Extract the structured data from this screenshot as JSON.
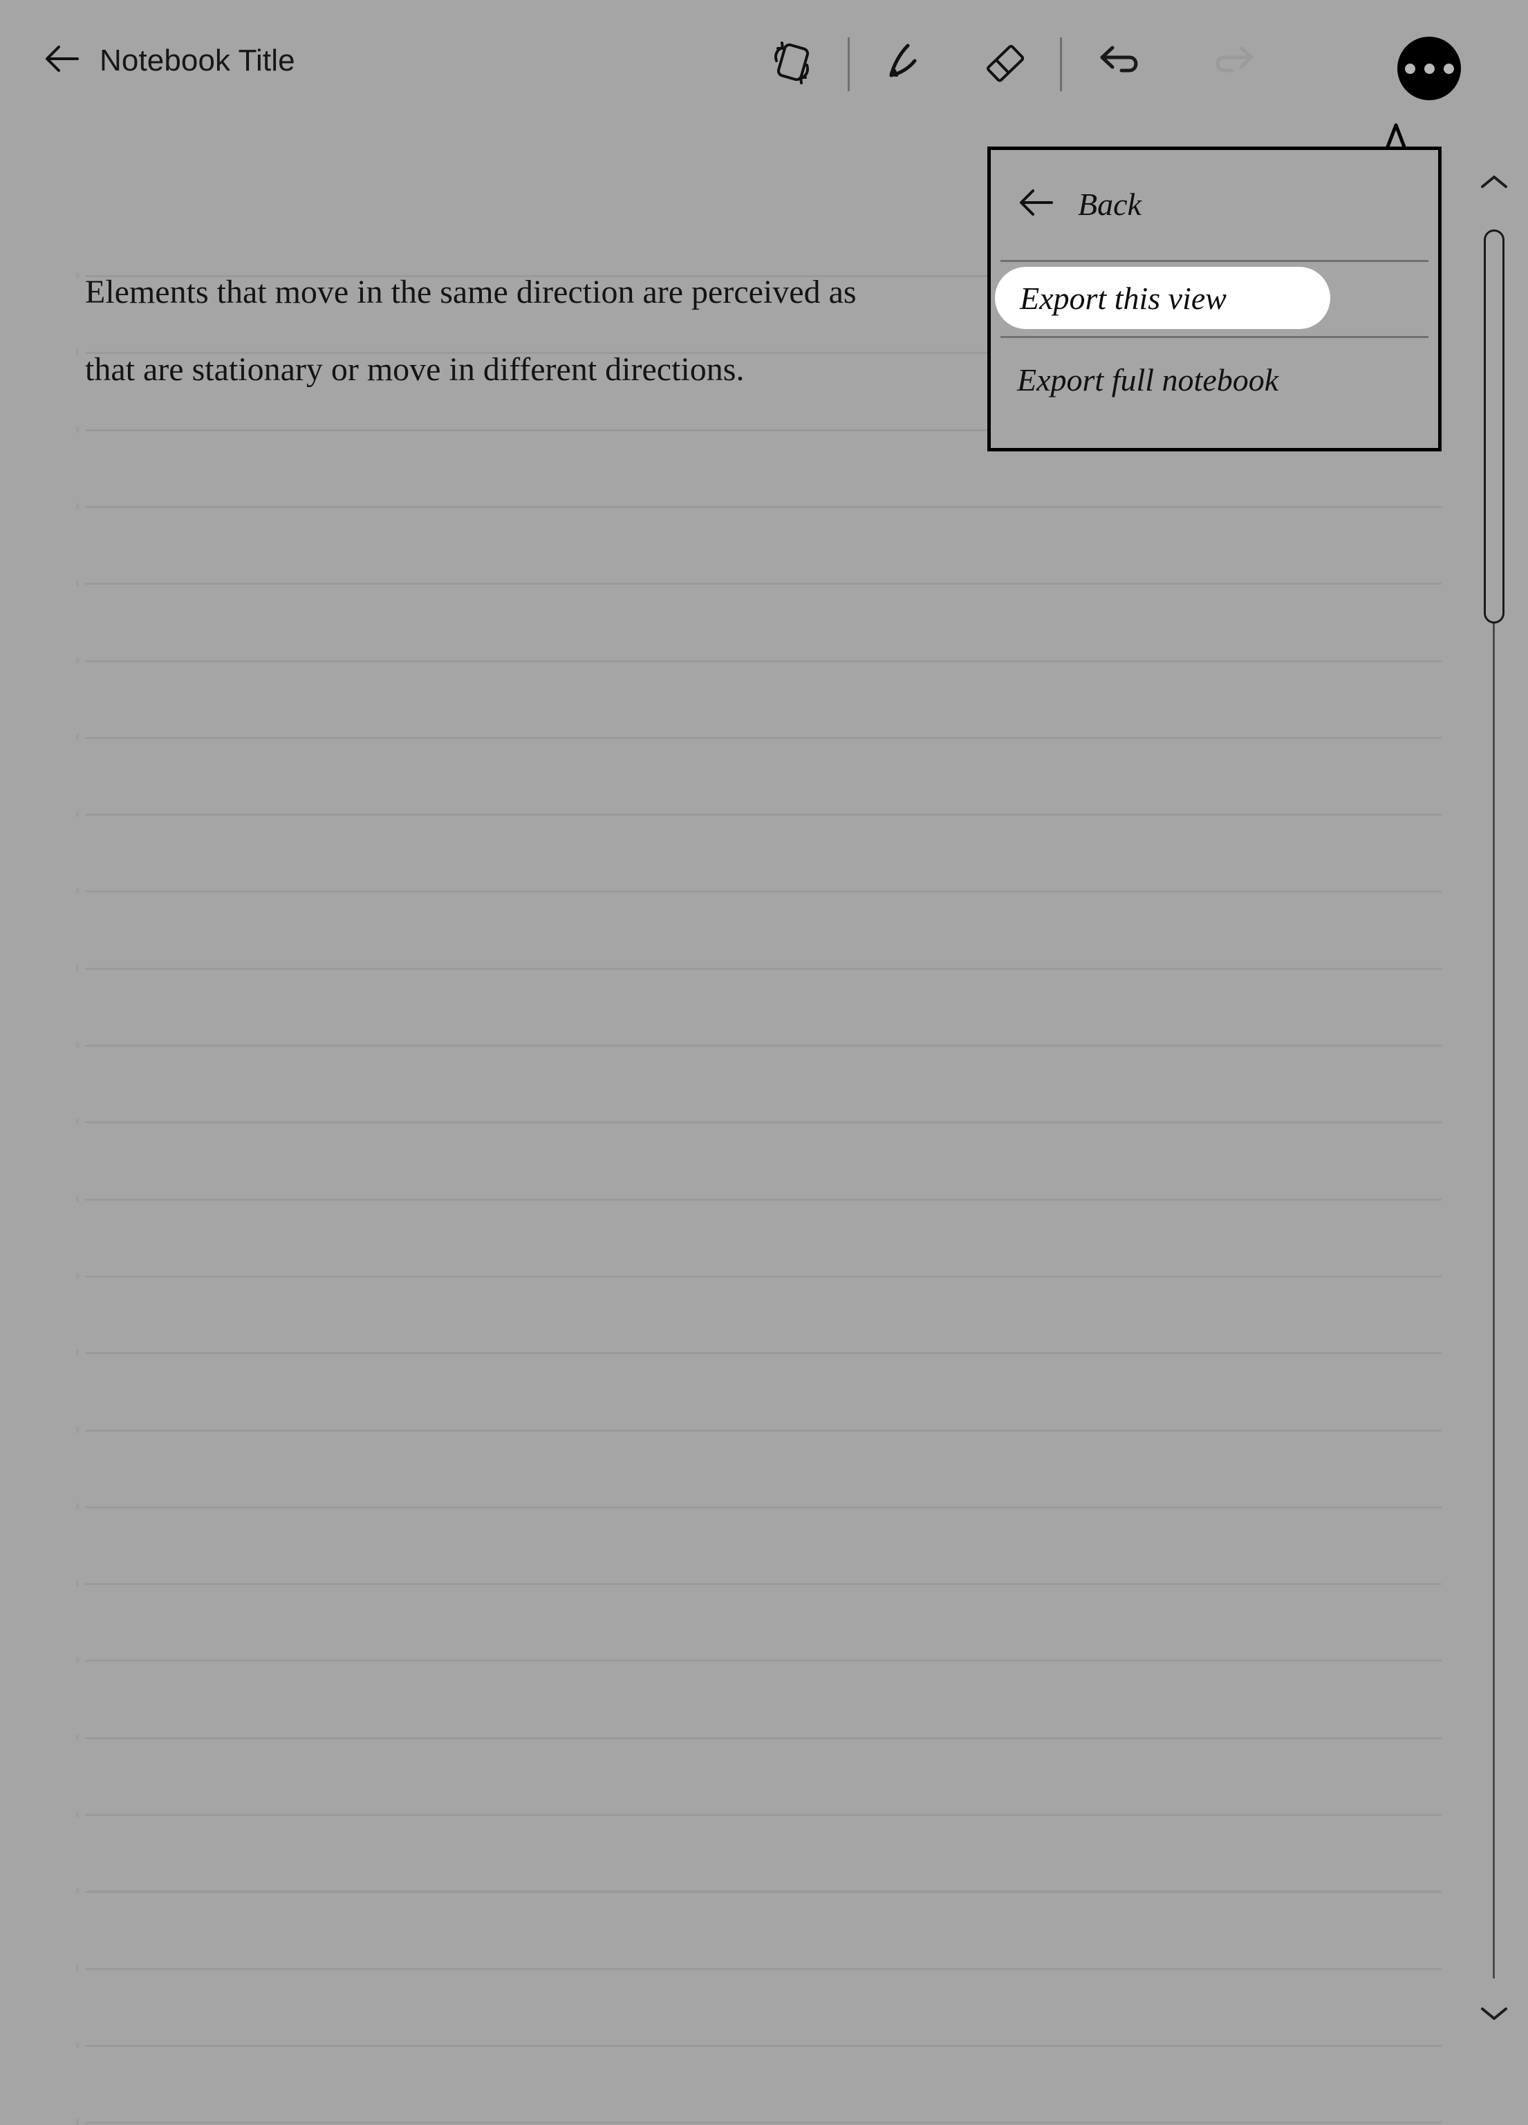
{
  "theme": {
    "background": "#a5a5a5",
    "rule_line_color": "#9a9a9a",
    "ink": "#111111",
    "accent_button": "#000000",
    "highlight_pill": "#ffffff"
  },
  "header": {
    "back_icon": "arrow-left-icon",
    "title": "Notebook Title",
    "tools": [
      {
        "name": "rotate-view-icon",
        "label": "Rotate view",
        "state": "enabled"
      },
      {
        "name": "pen-icon",
        "label": "Pen",
        "state": "enabled"
      },
      {
        "name": "eraser-icon",
        "label": "Eraser",
        "state": "enabled"
      },
      {
        "name": "undo-icon",
        "label": "Undo",
        "state": "enabled"
      },
      {
        "name": "redo-icon",
        "label": "Redo",
        "state": "disabled"
      }
    ],
    "more_button": {
      "name": "more-options-icon",
      "label": "More options",
      "dots": 3
    }
  },
  "note": {
    "lines": [
      "Elements that move in the same direction are perceived as",
      "that are stationary or move in different directions."
    ],
    "ruled_line_count": 25
  },
  "menu": {
    "back": {
      "icon": "arrow-left-icon",
      "label": "Back"
    },
    "items": [
      {
        "label": "Export this view",
        "selected": true
      },
      {
        "label": "Export full notebook",
        "selected": false
      }
    ]
  },
  "scrollbar": {
    "up_icon": "chevron-up-icon",
    "down_icon": "chevron-down-icon",
    "orientation": "vertical",
    "thumb_position_percent": 0
  }
}
